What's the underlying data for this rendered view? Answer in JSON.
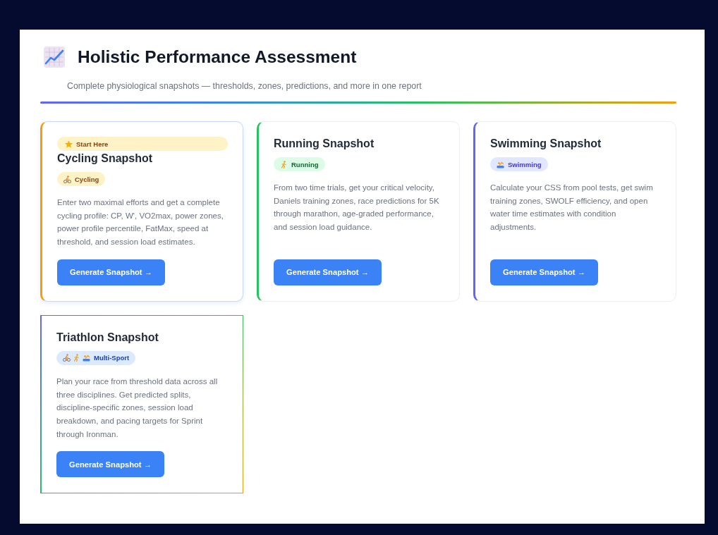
{
  "header": {
    "title": "Holistic Performance Assessment",
    "subtitle": "Complete physiological snapshots — thresholds, zones, predictions, and more in one report"
  },
  "cards": [
    {
      "kind": "cycling",
      "featured": true,
      "badge": "Start Here",
      "title": "Cycling Snapshot",
      "tag": "Cycling",
      "description": "Enter two maximal efforts and get a complete cycling profile: CP, W', VO2max, power zones, power profile percentile, FatMax, speed at threshold, and session load estimates.",
      "button": "Generate Snapshot →"
    },
    {
      "kind": "running",
      "featured": false,
      "title": "Running Snapshot",
      "tag": "Running",
      "description": "From two time trials, get your critical velocity, Daniels training zones, race predictions for 5K through marathon, age-graded performance, and session load guidance.",
      "button": "Generate Snapshot →"
    },
    {
      "kind": "swimming",
      "featured": false,
      "title": "Swimming Snapshot",
      "tag": "Swimming",
      "description": "Calculate your CSS from pool tests, get swim training zones, SWOLF efficiency, and open water time estimates with condition adjustments.",
      "button": "Generate Snapshot →"
    },
    {
      "kind": "triathlon",
      "featured": false,
      "title": "Triathlon Snapshot",
      "tag": "Multi-Sport",
      "description": "Plan your race from threshold data across all three disciplines. Get predicted splits, discipline-specific zones, session load breakdown, and pacing targets for Sprint through Ironman.",
      "button": "Generate Snapshot →"
    }
  ]
}
